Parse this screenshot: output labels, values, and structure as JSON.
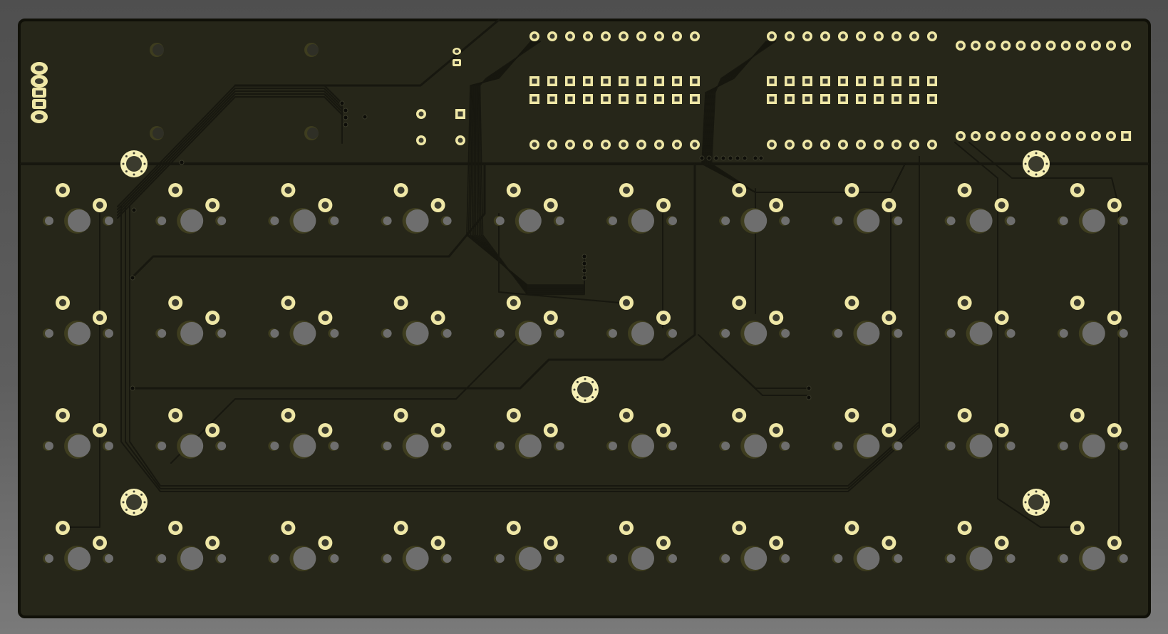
{
  "board": {
    "colors": {
      "background": "#575757",
      "board_fill": "#262619",
      "board_edge": "#101008",
      "trace": "#17170f",
      "pad": "#efe7a6",
      "pad_ring": "#f6efb5",
      "drill": "#3b3b2e",
      "switch_hole": "#6e6e6e",
      "switch_hole_shadow": "#3e3d1f",
      "via": "#0d0d08"
    },
    "switch_grid": {
      "columns": 10,
      "rows": 4
    },
    "headers": {
      "round_pin_rows": 4,
      "square_pin_rows": 4,
      "pins_per_row": 10,
      "right_header_pins_per_row": 12
    }
  }
}
